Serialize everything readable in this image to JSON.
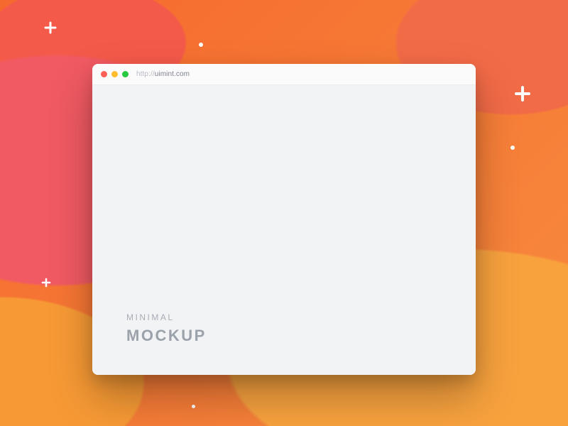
{
  "browser": {
    "url_protocol": "http://",
    "url_host": "uimint.com"
  },
  "content": {
    "subtitle": "MINIMAL",
    "title": "MOCKUP"
  }
}
